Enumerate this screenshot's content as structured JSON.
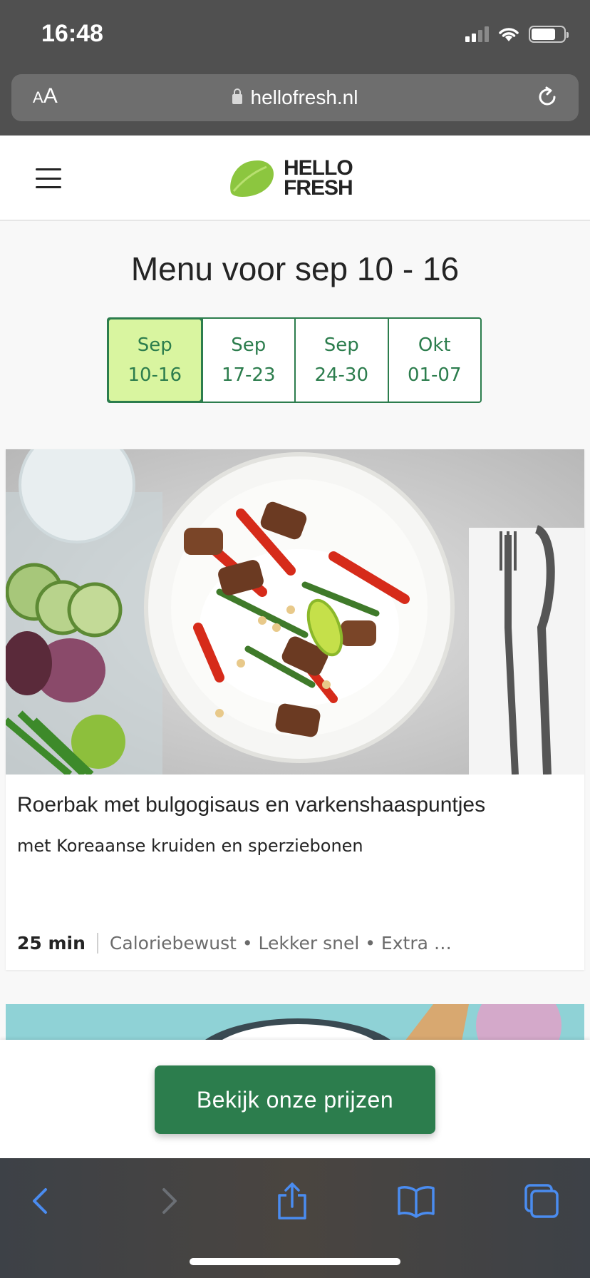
{
  "status_bar": {
    "time": "16:48",
    "battery_level": 0.75
  },
  "browser": {
    "text_size_label_small": "A",
    "text_size_label_large": "A",
    "url": "hellofresh.nl"
  },
  "header": {
    "logo_line1": "HELLO",
    "logo_line2": "FRESH"
  },
  "menu": {
    "title": "Menu voor sep 10 - 16",
    "weeks": [
      {
        "month": "Sep",
        "range": "10-16",
        "active": true
      },
      {
        "month": "Sep",
        "range": "17-23",
        "active": false
      },
      {
        "month": "Sep",
        "range": "24-30",
        "active": false
      },
      {
        "month": "Okt",
        "range": "01-07",
        "active": false
      }
    ]
  },
  "recipe": {
    "title": "Roerbak met bulgogisaus en varkenshaaspuntjes",
    "subtitle": "met Koreaanse kruiden en sperziebonen",
    "time": "25 min",
    "tags": "Caloriebewust • Lekker snel • Extra …"
  },
  "cta": {
    "label": "Bekijk onze prijzen"
  },
  "colors": {
    "brand_green": "#2c7d4d",
    "active_week_bg": "#d9f5a0",
    "logo_lime": "#8cc63f"
  },
  "toolbar": {
    "icons": [
      "back-icon",
      "forward-icon",
      "share-icon",
      "bookmarks-icon",
      "tabs-icon"
    ]
  }
}
